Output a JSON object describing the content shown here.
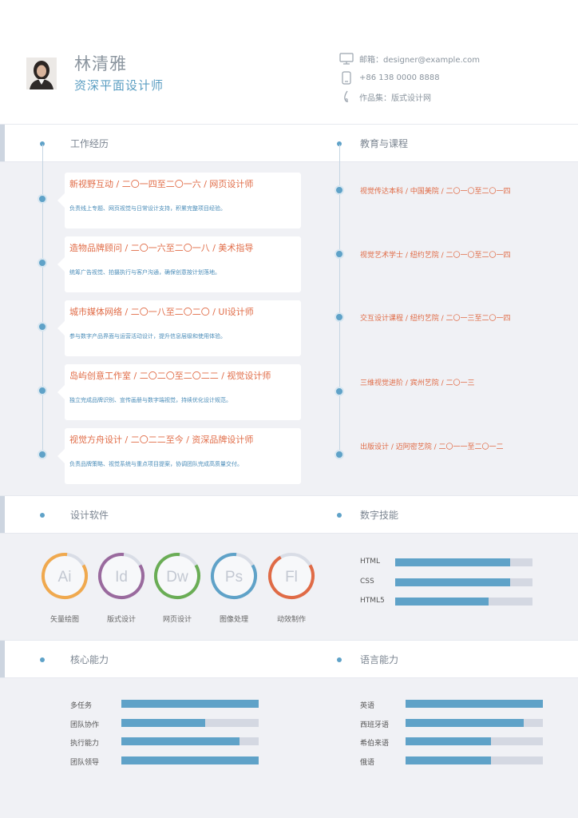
{
  "profile": {
    "name": "林清雅",
    "role": "资深平面设计师"
  },
  "contact": [
    {
      "icon": "monitor-icon",
      "text": "邮箱：designer@example.com"
    },
    {
      "icon": "phone-icon",
      "text": "+86 138 0000 8888"
    },
    {
      "icon": "pen-icon",
      "text": "作品集：版式设计网"
    }
  ],
  "sections": {
    "work": "工作经历",
    "education": "教育与课程",
    "software": "设计软件",
    "digital": "数字技能",
    "core": "核心能力",
    "language": "语言能力"
  },
  "work": [
    {
      "title": "新视野互动 / 二〇一四至二〇一六 / 网页设计师",
      "desc": "负责线上专题、网页视觉与日常设计支持，积累完整项目经验。"
    },
    {
      "title": "造物品牌顾问 / 二〇一六至二〇一八 / 美术指导",
      "desc": "统筹广告视觉、拍摄执行与客户沟通，确保创意按计划落地。"
    },
    {
      "title": "城市媒体网络 / 二〇一八至二〇二〇 / UI设计师",
      "desc": "参与数字产品界面与运营活动设计，提升信息层级和使用体验。"
    },
    {
      "title": "岛屿创意工作室 / 二〇二〇至二〇二二 / 视觉设计师",
      "desc": "独立完成品牌识别、宣传画册与数字端视觉，持续优化设计规范。"
    },
    {
      "title": "视觉方舟设计 / 二〇二二至今 / 资深品牌设计师",
      "desc": "负责品牌策略、视觉系统与重点项目提案，协调团队完成高质量交付。"
    }
  ],
  "education": [
    "视觉传达本科 / 中国美院 / 二〇一〇至二〇一四",
    "视觉艺术学士 / 纽约艺院 / 二〇一〇至二〇一四",
    "交互设计课程 / 纽约艺院 / 二〇一三至二〇一四",
    "三维视觉进阶 / 宾州艺院 / 二〇一三",
    "出版设计 / 迈阿密艺院 / 二〇一一至二〇一二"
  ],
  "software": [
    {
      "abbr": "Ai",
      "label": "矢量绘图",
      "level": 0.85,
      "color": "#f0a94e"
    },
    {
      "abbr": "Id",
      "label": "版式设计",
      "level": 0.85,
      "color": "#9a6a9e"
    },
    {
      "abbr": "Dw",
      "label": "网页设计",
      "level": 0.85,
      "color": "#6aad55"
    },
    {
      "abbr": "Ps",
      "label": "图像处理",
      "level": 0.85,
      "color": "#5fa2c8"
    },
    {
      "abbr": "Fl",
      "label": "动效制作",
      "level": 0.75,
      "color": "#e06b46"
    }
  ],
  "digital": [
    {
      "label": "HTML",
      "level": 0.84
    },
    {
      "label": "CSS",
      "level": 0.84
    },
    {
      "label": "HTML5",
      "level": 0.68
    }
  ],
  "core": [
    {
      "label": "多任务",
      "level": 1.0
    },
    {
      "label": "团队协作",
      "level": 0.61
    },
    {
      "label": "执行能力",
      "level": 0.86
    },
    {
      "label": "团队领导",
      "level": 1.0
    }
  ],
  "language": [
    {
      "label": "英语",
      "level": 1.0
    },
    {
      "label": "西班牙语",
      "level": 0.86
    },
    {
      "label": "希伯来语",
      "level": 0.62
    },
    {
      "label": "俄语",
      "level": 0.62
    }
  ],
  "colors": {
    "accent_blue": "#5fa2c8",
    "accent_orange": "#e06b46",
    "band_bg": "#f0f1f5"
  }
}
